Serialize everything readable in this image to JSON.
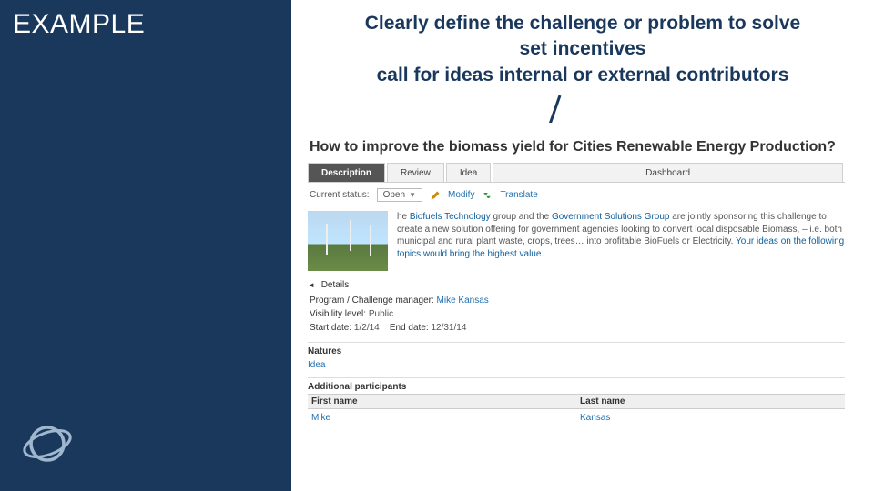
{
  "slide": {
    "sidebar_label": "EXAMPLE",
    "headline_line1": "Clearly define the challenge or problem to solve",
    "headline_line2": "set incentives",
    "headline_line3": "call for ideas internal or external contributors"
  },
  "app": {
    "breadcrumb": "",
    "title": "How to improve the biomass yield for Cities Renewable Energy Production?",
    "tabs": {
      "description": "Description",
      "review": "Review",
      "idea": "Idea",
      "dashboard": "Dashboard"
    },
    "toolbar": {
      "current_status_label": "Current status:",
      "status_value": "Open",
      "modify_label": "Modify",
      "translate_label": "Translate"
    },
    "description": {
      "p1a": "he ",
      "hl1": "Biofuels Technology",
      "p1b": " group and the ",
      "hl2": "Government Solutions Group",
      "p1c": " are jointly sponsoring this challenge to create a new solution offering for government agencies looking to convert local disposable Biomass, – i.e. both municipal and rural plant waste, crops, trees… into profitable BioFuels or Electricity. ",
      "hl3": "Your ideas on the following topics would bring the highest value."
    },
    "details": {
      "header": "Details",
      "program_label": "Program / Challenge manager:",
      "program_value": "Mike Kansas",
      "visibility_label": "Visibility level:",
      "visibility_value": "Public",
      "start_label": "Start date:",
      "start_value": "1/2/14",
      "end_label": "End date:",
      "end_value": "12/31/14"
    },
    "natures": {
      "header": "Natures",
      "value": "Idea"
    },
    "participants": {
      "header": "Additional participants",
      "col_first": "First name",
      "col_last": "Last name",
      "rows": [
        {
          "first": "Mike",
          "last": "Kansas"
        }
      ]
    }
  }
}
